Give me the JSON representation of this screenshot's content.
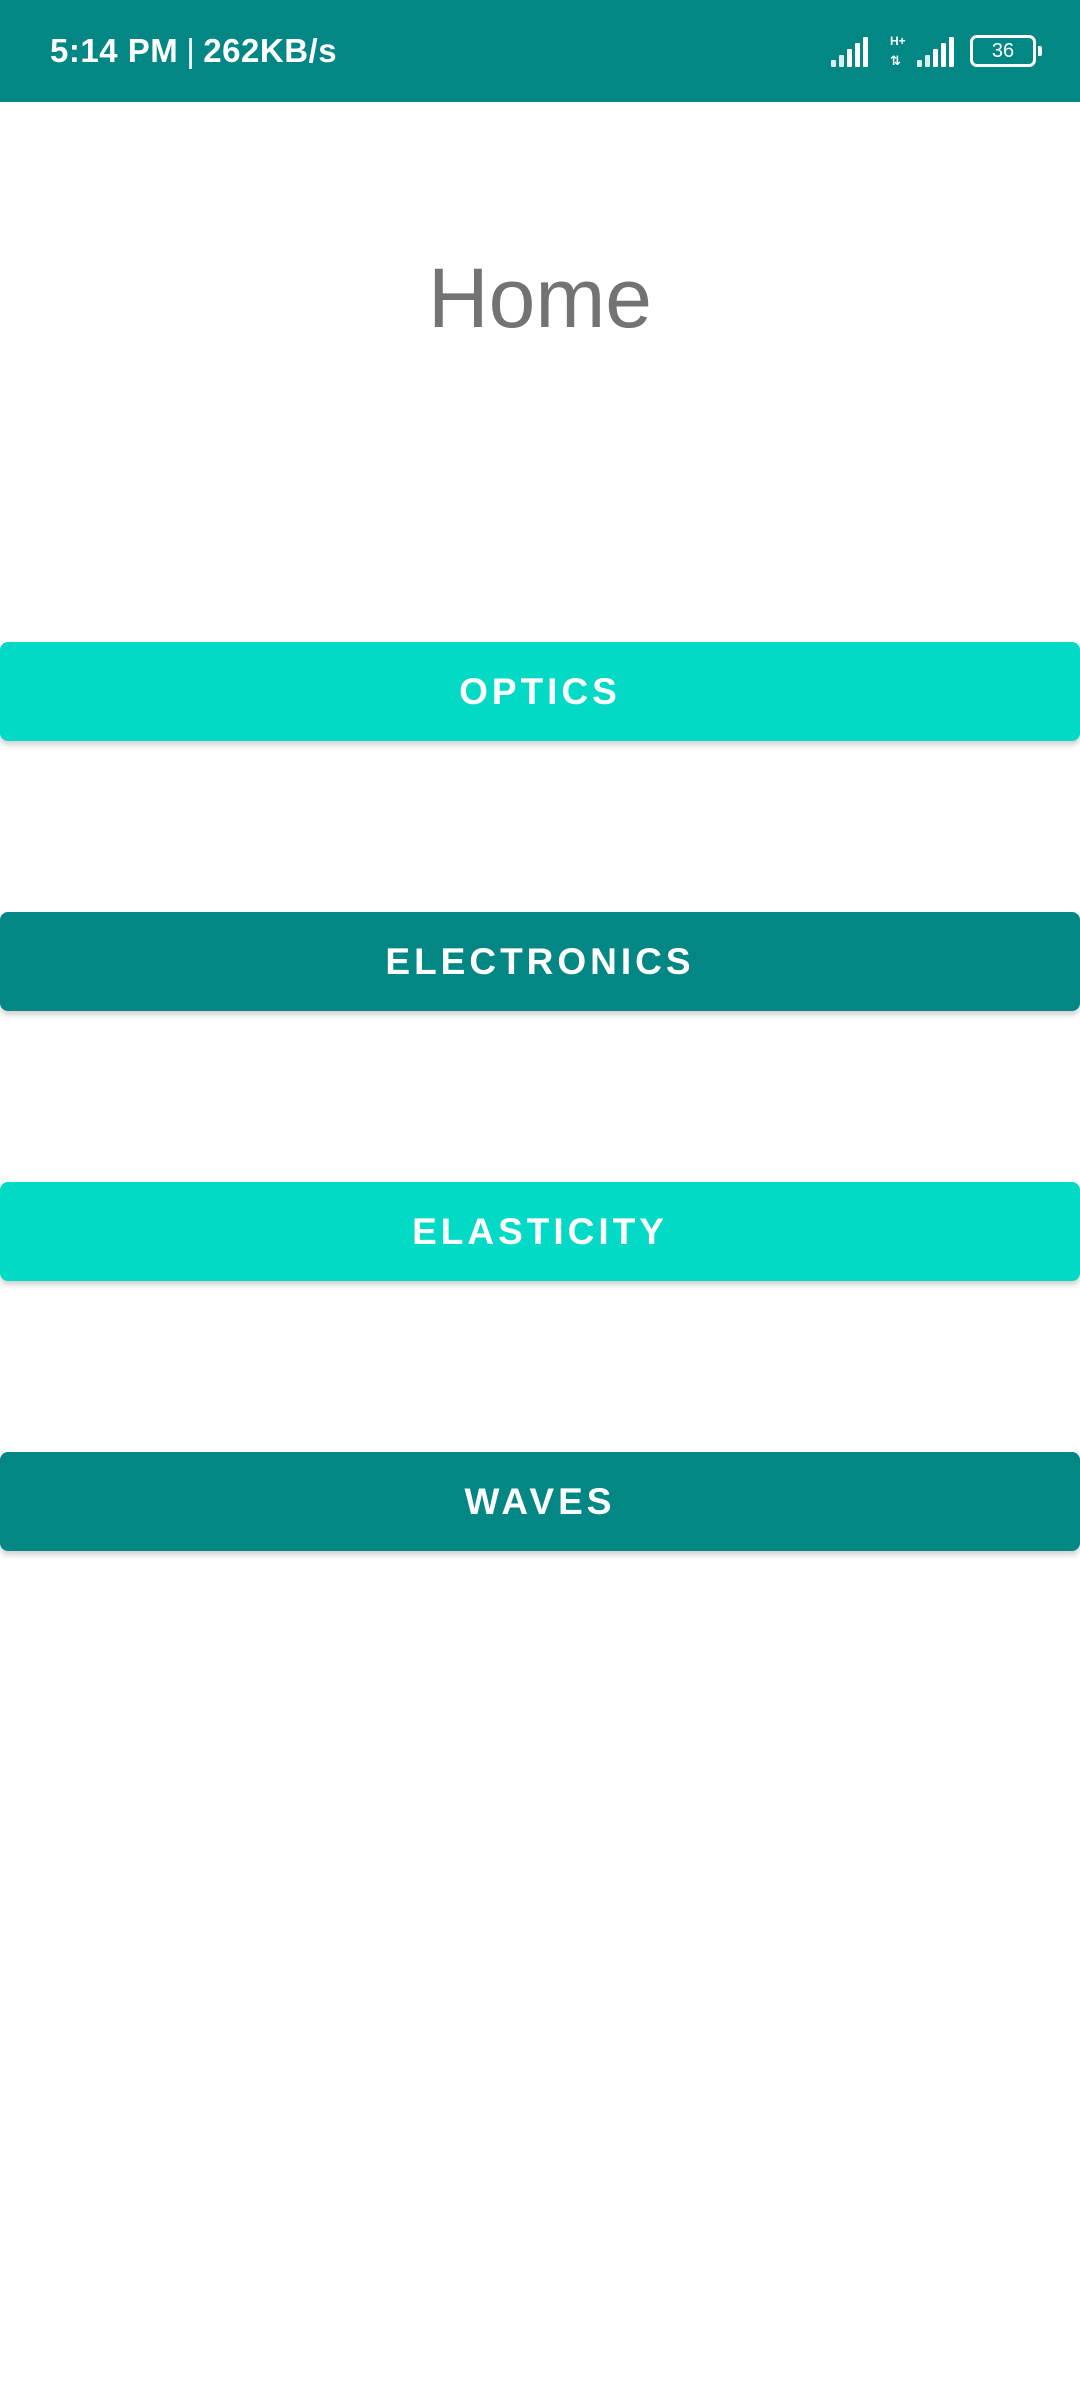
{
  "status_bar": {
    "time": "5:14 PM",
    "separator": "|",
    "net_speed": "262KB/s",
    "network_type": "H+",
    "battery_level": "36",
    "background_color": "#028784"
  },
  "main": {
    "title": "Home",
    "buttons": [
      {
        "label": "OPTICS",
        "color": "#03dac5"
      },
      {
        "label": "ELECTRONICS",
        "color": "#028784"
      },
      {
        "label": "ELASTICITY",
        "color": "#03dac5"
      },
      {
        "label": "WAVES",
        "color": "#028784"
      }
    ]
  }
}
